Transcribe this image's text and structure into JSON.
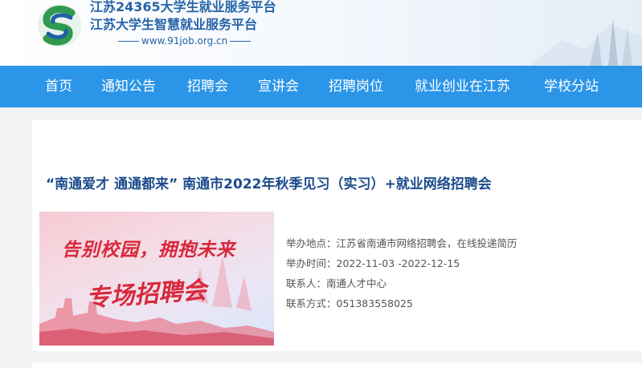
{
  "header": {
    "title_line1": "江苏24365大学生就业服务平台",
    "title_line2": "江苏大学生智慧就业服务平台",
    "url": "www.91job.org.cn"
  },
  "nav": {
    "items": [
      {
        "label": "首页"
      },
      {
        "label": "通知公告"
      },
      {
        "label": "招聘会"
      },
      {
        "label": "宣讲会"
      },
      {
        "label": "招聘岗位"
      },
      {
        "label": "就业创业在江苏"
      },
      {
        "label": "学校分站"
      }
    ]
  },
  "event": {
    "title": "“南通爱才 通通都来” 南通市2022年秋季见习（实习）+就业网络招聘会",
    "banner": {
      "line1": "告别校园，拥抱未来",
      "line2": "专场招聘会"
    },
    "location": "举办地点：江苏省南通市网络招聘会，在线投递简历",
    "time": "举办时间：2022-11-03 -2022-12-15",
    "contact": "联系人：南通人才中心",
    "phone": "联系方式：051383558025"
  },
  "colors": {
    "nav_bg": "#2b95e8",
    "title_blue": "#1e4c8c",
    "brand_blue": "#2564a8",
    "banner_red": "#d8283c"
  }
}
